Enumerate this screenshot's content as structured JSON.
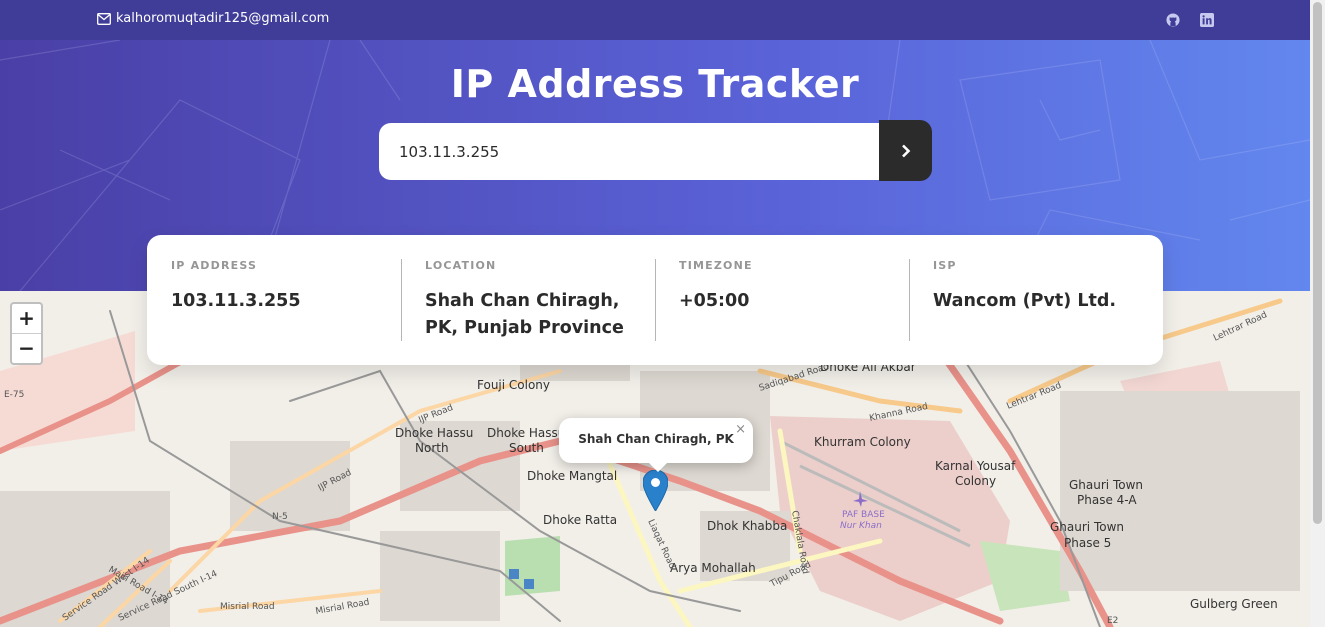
{
  "topbar": {
    "email": "kalhoromuqtadir125@gmail.com",
    "icons": [
      "mail-icon",
      "github-icon",
      "linkedin-icon"
    ]
  },
  "hero": {
    "title": "IP Address Tracker"
  },
  "search": {
    "value": "103.11.3.255",
    "button_icon": "chevron-right-icon"
  },
  "info": {
    "ip": {
      "label": "IP ADDRESS",
      "value": "103.11.3.255"
    },
    "location": {
      "label": "LOCATION",
      "value_line1": "Shah Chan Chiragh,",
      "value_line2": "PK, Punjab Province"
    },
    "timezone": {
      "label": "TIMEZONE",
      "value": "+05:00"
    },
    "isp": {
      "label": "ISP",
      "value": "Wancom (Pvt) Ltd."
    }
  },
  "map": {
    "zoom_in": "+",
    "zoom_out": "−",
    "popup_text": "Shah Chan Chiragh, PK",
    "popup_close": "×",
    "labels": [
      "Fouji Colony",
      "Dhoke Hassu North",
      "Dhoke Hassu South",
      "Dhoke Mangtal",
      "Dhoke Ratta",
      "Dhok Khabba",
      "Arya Mohallah",
      "Khurram Colony",
      "Karnal Yousaf Colony",
      "Ghauri Town Phase 4-A",
      "Ghauri Town Phase 5",
      "Gulberg Green",
      "Dhoke Ali Akbar",
      "PAF BASE Nur Khan",
      "IJP Road",
      "N-5",
      "E-75",
      "Misrial Road",
      "Khanna Road",
      "Lehtrar Road",
      "Tipu Road",
      "Sadiqabad Road",
      "Chaklala Road",
      "Service Road West I-14",
      "Service Road South I-14",
      "Main Road I-14",
      "Liaqat Road",
      "E2"
    ]
  },
  "colors": {
    "topbar": "#3f3d98",
    "hero_start": "#4a3fa6",
    "hero_end": "#6287ee",
    "button": "#2b2b2b",
    "marker": "#2a81cb"
  }
}
